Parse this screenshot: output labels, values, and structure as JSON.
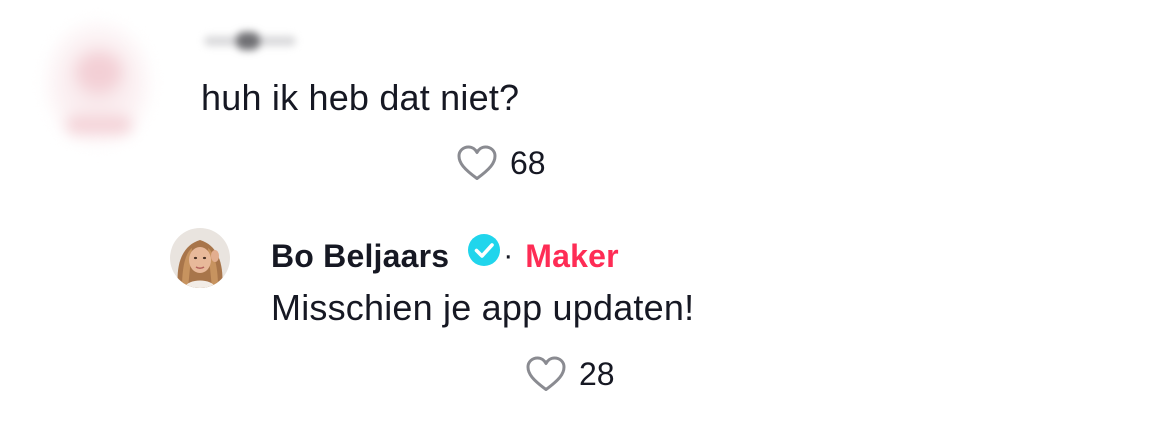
{
  "comments": [
    {
      "text": "huh ik heb dat niet?",
      "likes": "68",
      "icons": {
        "avatar": "blurred-avatar",
        "like": "heart-outline-icon"
      }
    }
  ],
  "reply": {
    "author": "Bo Beljaars",
    "separator": "·",
    "badge": "Maker",
    "text": "Misschien je app updaten!",
    "likes": "28",
    "icons": {
      "verified": "verified-check-icon",
      "like": "heart-outline-icon"
    }
  },
  "colors": {
    "text": "#161823",
    "badge": "#fe2c55",
    "verified": "#20d5ec",
    "heart_outline": "#8a8b91"
  }
}
